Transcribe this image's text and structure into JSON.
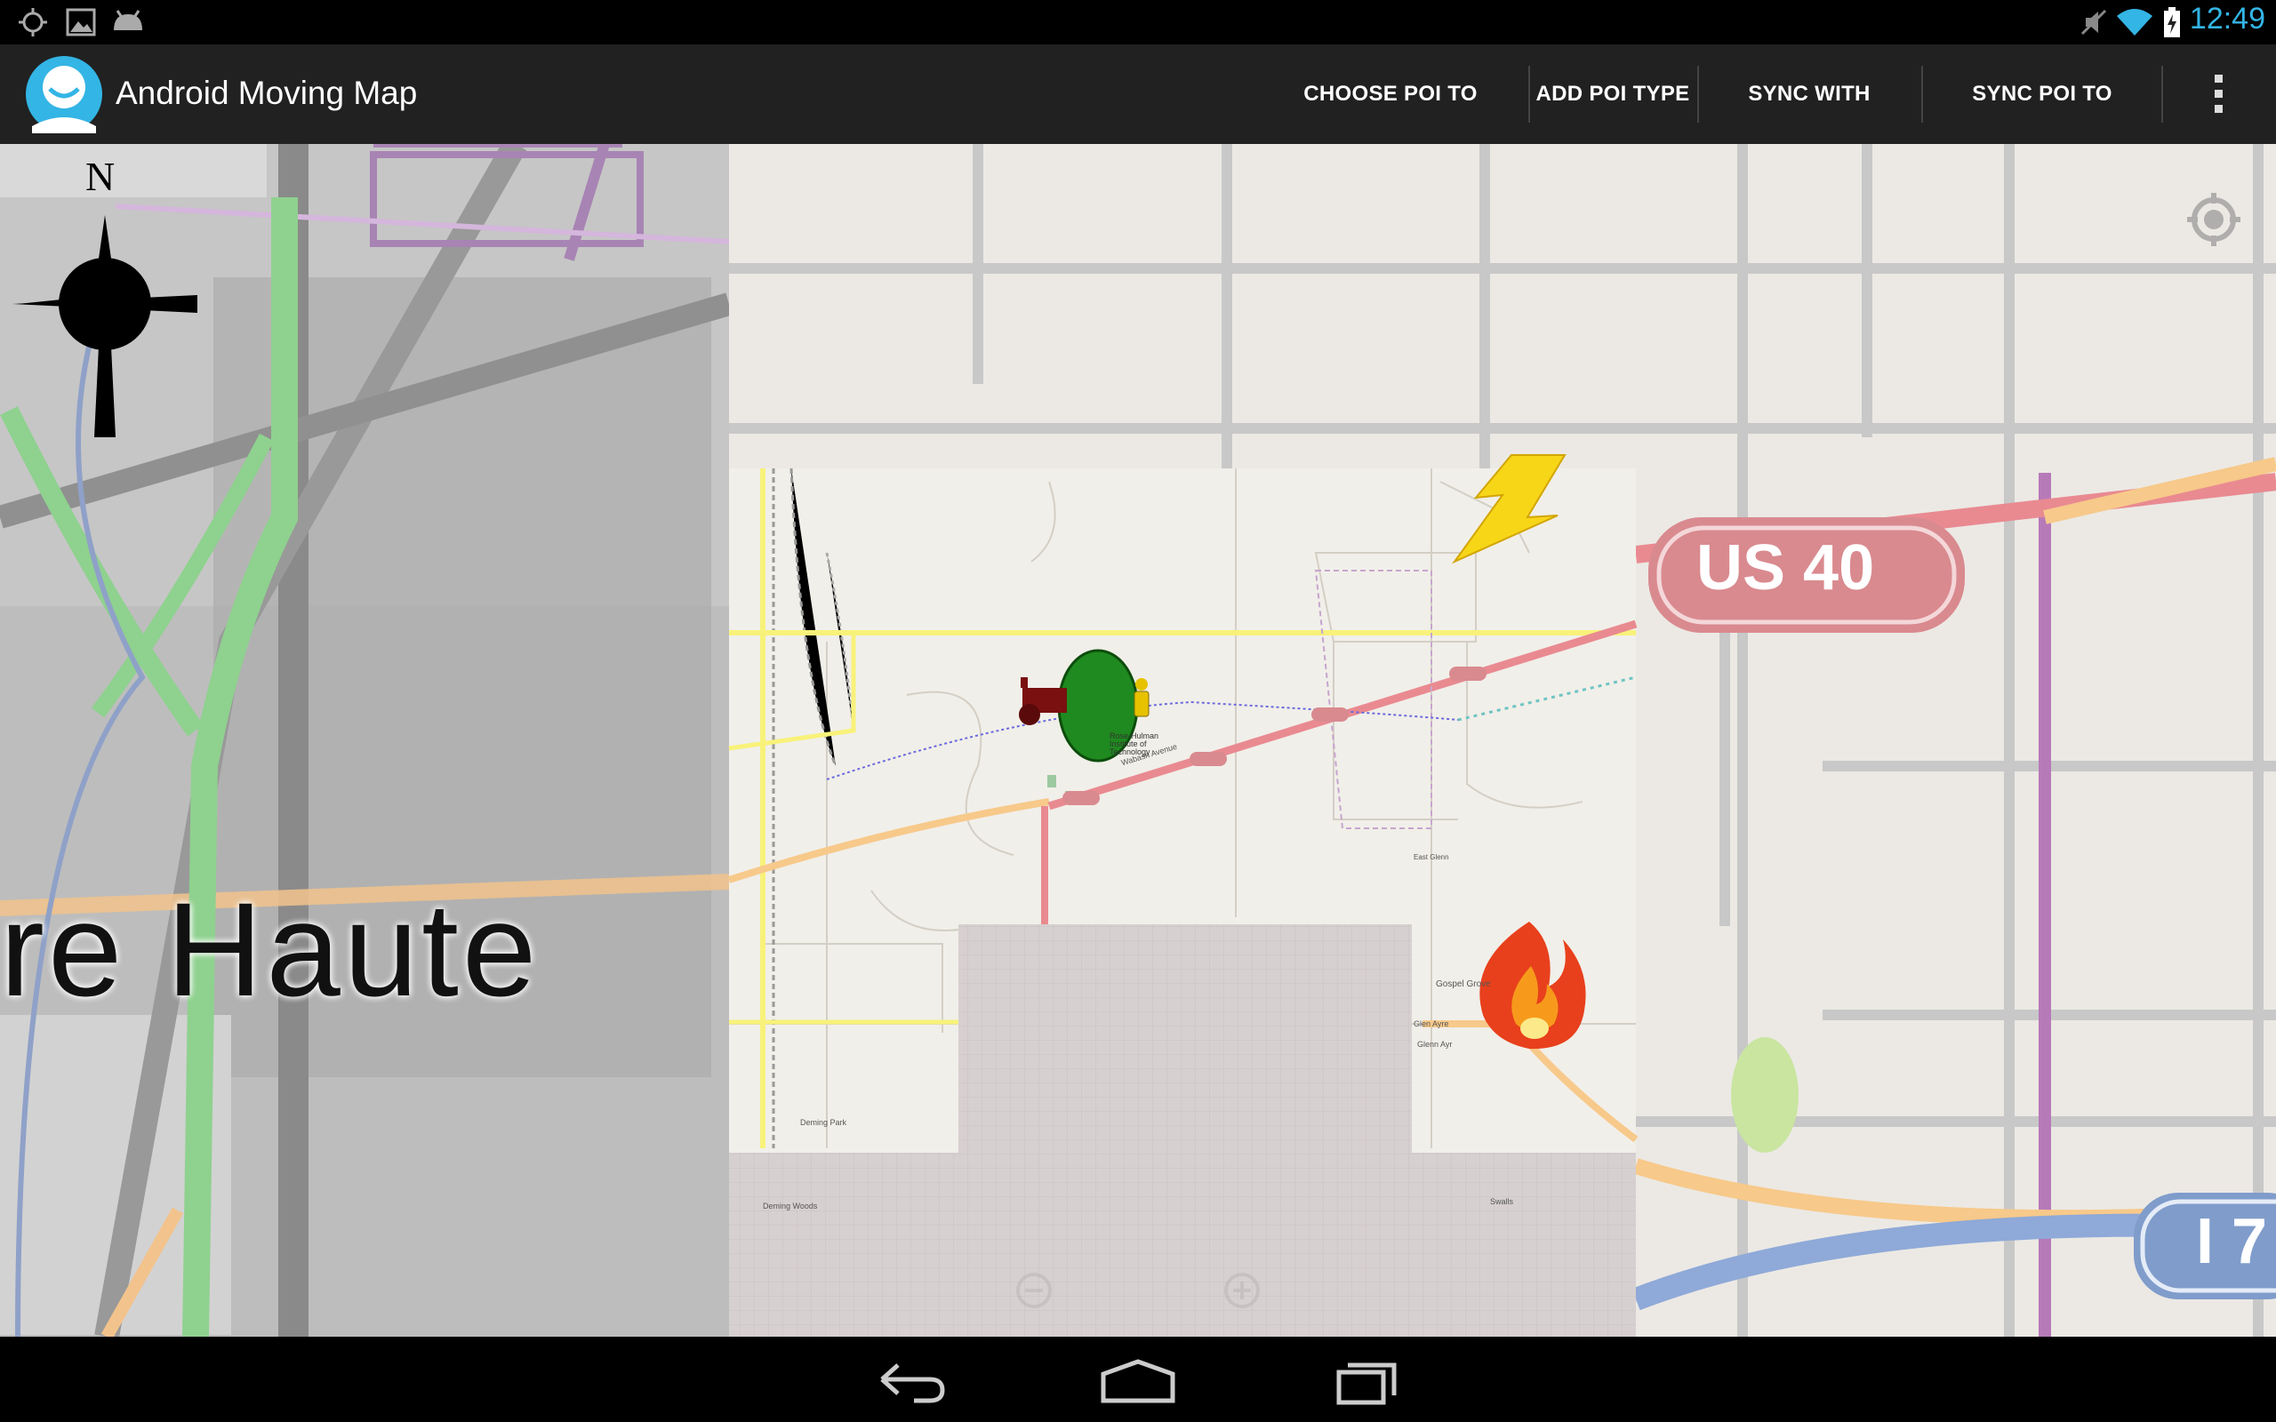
{
  "status_bar": {
    "time": "12:49",
    "left_icons": [
      "gps-icon",
      "image-icon",
      "android-debug-icon"
    ],
    "right_icons": [
      "mute-icon",
      "wifi-icon",
      "battery-charging-icon"
    ]
  },
  "action_bar": {
    "title": "Android Moving Map",
    "actions": [
      {
        "label": "CHOOSE POI TO DISPLAY"
      },
      {
        "label": "ADD POI TYPE"
      },
      {
        "label": "SYNC WITH SERVER"
      },
      {
        "label": "SYNC POI TO SERVER"
      }
    ],
    "overflow_icon": "overflow-menu-icon"
  },
  "map": {
    "compass_letter": "N",
    "city_label": "re Haute",
    "highway_shield_large": "US 40",
    "interstate_shield_partial": "I 7",
    "small_shield": "US 40",
    "street_label": "Wabash Avenue",
    "place_labels": [
      "Gospel Grove",
      "Glen Ayre",
      "Glenn Ayr",
      "East Glenn",
      "Deming Park",
      "Deming Woods",
      "Swalls",
      "Rose-Hulman Institute of Technology"
    ],
    "poi_icons": [
      "lightning-icon",
      "fire-icon",
      "tree-icon",
      "cannon-icon",
      "person-icon"
    ],
    "colors": {
      "highway": "#d98a8f",
      "secondary": "#f7c98a",
      "tertiary": "#f8f27a",
      "park": "#c9e5a0",
      "water": "#8fa9d8"
    }
  },
  "nav_bar": {
    "buttons": [
      "back-icon",
      "home-icon",
      "recents-icon"
    ]
  }
}
